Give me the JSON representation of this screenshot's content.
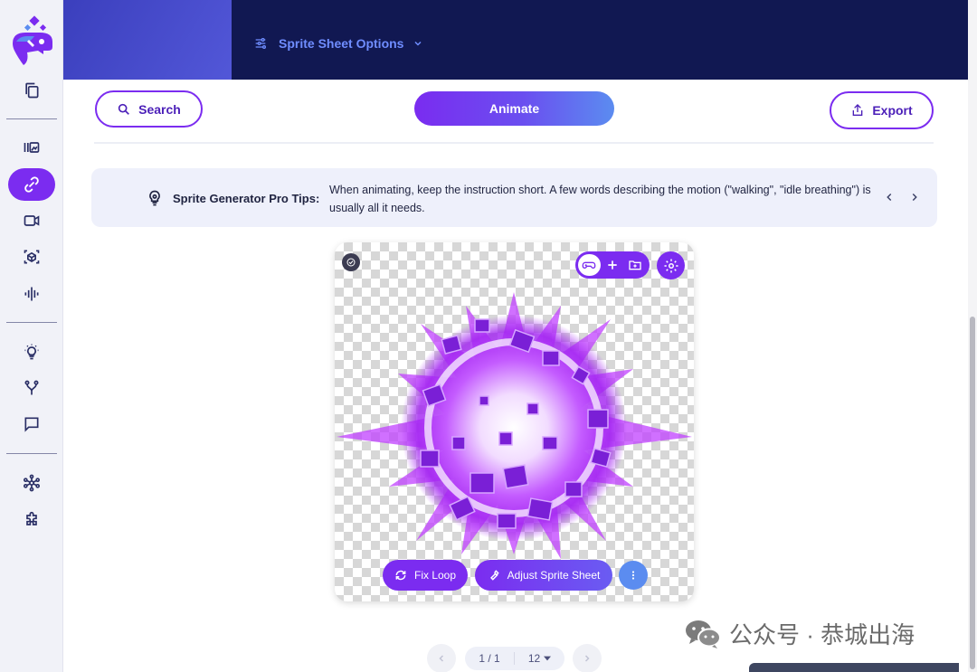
{
  "topbar": {
    "options_label": "Sprite Sheet Options"
  },
  "actions": {
    "search_label": "Search",
    "animate_label": "Animate",
    "export_label": "Export"
  },
  "tips": {
    "title": "Sprite Generator Pro Tips:",
    "text": "When animating, keep the instruction short. A few words describing the motion (\"walking\", \"idle breathing\") is usually all it needs."
  },
  "card": {
    "fix_loop_label": "Fix Loop",
    "adjust_label": "Adjust Sprite Sheet"
  },
  "pager": {
    "page": "1 / 1",
    "fps": "12"
  },
  "watermark": {
    "text": "公众号 · 恭城出海"
  },
  "colors": {
    "accent": "#7b2cf0",
    "topbar": "#111852",
    "link": "#6f8dff",
    "animate_end": "#5b8cf0"
  },
  "sidebar": {
    "items": [
      "copy-icon",
      "gallery-icon",
      "link-icon",
      "video-icon",
      "cube-icon",
      "audio-icon",
      "bulb-icon",
      "fork-icon",
      "chat-icon",
      "network-icon",
      "puzzle-icon"
    ],
    "active": "link-icon"
  }
}
